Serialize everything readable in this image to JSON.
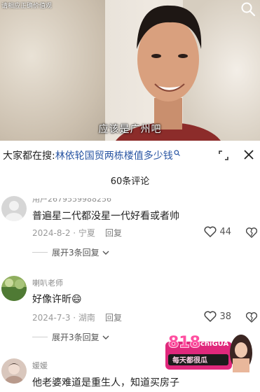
{
  "video": {
    "watermark": "请相应正确价值观",
    "subtitle": "应该是广州吧"
  },
  "search_bar": {
    "prefix": "大家都在搜:",
    "query": "林依轮国贸两栋楼值多少钱",
    "query_icon": "search-small-icon"
  },
  "comments_header": {
    "count_label": "60条评论"
  },
  "comments": [
    {
      "username": "用户2679559988256",
      "text": "普遍星二代都没星一代好看或者帅",
      "date": "2024-8-2",
      "location": "宁夏",
      "reply_label": "回复",
      "likes": "44",
      "expand_label": "展开3条回复"
    },
    {
      "username": "喇叭老师",
      "text": "好像许昕",
      "emoji": "😄",
      "date": "2024-7-3",
      "location": "湖南",
      "reply_label": "回复",
      "likes": "38",
      "expand_label": "展开3条回复"
    },
    {
      "username": "媛媛",
      "text": "他老婆难道是重生人，知道买房子"
    }
  ],
  "ad": {
    "brand": "818",
    "sub": "chiGUA",
    "tagline": "每天都很瓜"
  },
  "colors": {
    "link": "#2a56a3",
    "muted": "#9a9a9a",
    "ad_pink": "#e0287c"
  }
}
